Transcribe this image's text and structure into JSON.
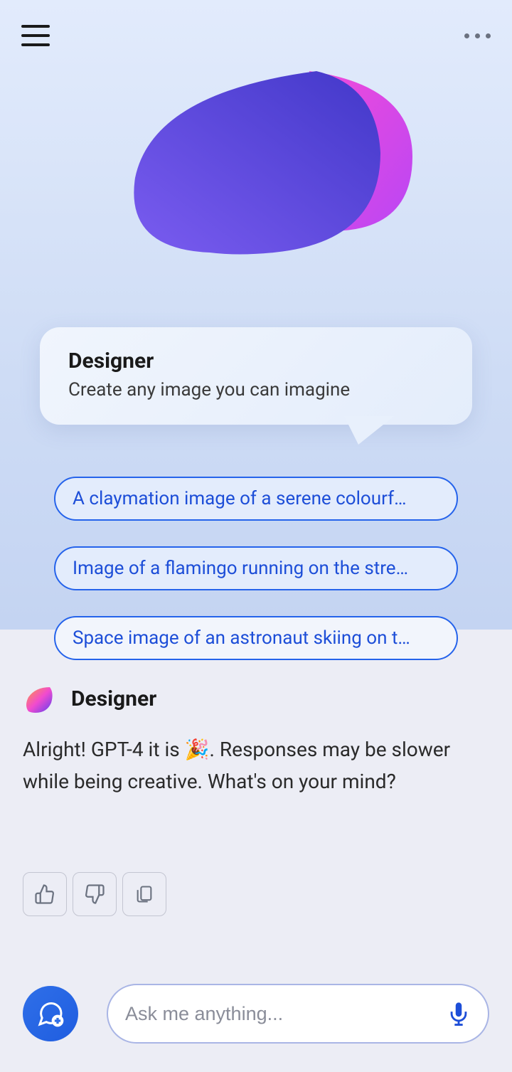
{
  "hero": {
    "title": "Designer",
    "subtitle": "Create any image you can imagine"
  },
  "suggestions": [
    "A claymation image of a serene colourf…",
    "Image of a flamingo running on the stre…",
    "Space image of an astronaut skiing on t…"
  ],
  "response": {
    "sender": "Designer",
    "text": "Alright! GPT-4 it is 🎉. Responses may be slower while being creative. What's on your mind?"
  },
  "composer": {
    "placeholder": "Ask me anything..."
  },
  "icons": {
    "menu": "menu",
    "more": "more",
    "thumbs_up": "thumbs-up",
    "thumbs_down": "thumbs-down",
    "copy": "copy",
    "new_chat": "new-chat",
    "mic": "mic"
  }
}
